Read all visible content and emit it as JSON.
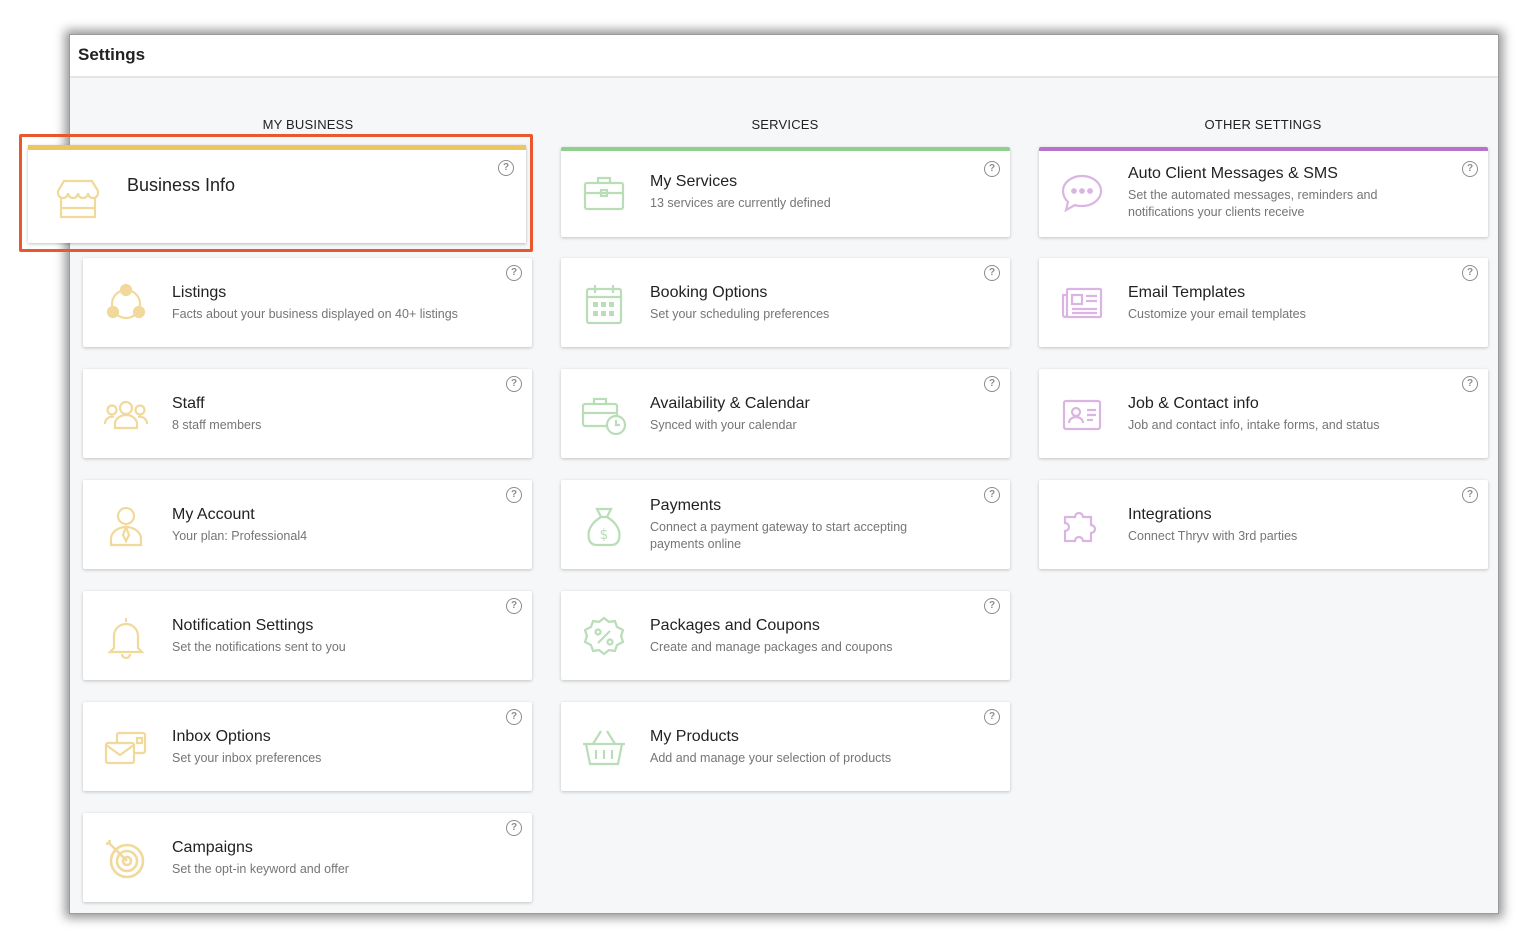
{
  "window": {
    "title": "Settings"
  },
  "colors": {
    "business": "#ecc75f",
    "services": "#8fd18c",
    "other": "#b673c9",
    "business_icon": "#f0d99a",
    "services_icon": "#b9ddb7",
    "other_icon": "#dab5e3",
    "highlight": "#e8582c"
  },
  "columns": {
    "business": {
      "heading": "MY BUSINESS"
    },
    "services": {
      "heading": "SERVICES"
    },
    "other": {
      "heading": "OTHER SETTINGS"
    }
  },
  "help_glyph": "?",
  "business_cards": [
    {
      "title": "Business Info",
      "subtitle": "",
      "icon": "storefront-icon"
    },
    {
      "title": "Listings",
      "subtitle": "Facts about your business displayed on 40+ listings",
      "icon": "network-icon"
    },
    {
      "title": "Staff",
      "subtitle": "8 staff members",
      "icon": "people-icon"
    },
    {
      "title": "My Account",
      "subtitle": "Your plan: Professional4",
      "icon": "person-icon"
    },
    {
      "title": "Notification Settings",
      "subtitle": "Set the notifications sent to you",
      "icon": "bell-icon"
    },
    {
      "title": "Inbox Options",
      "subtitle": "Set your inbox preferences",
      "icon": "envelopes-icon"
    },
    {
      "title": "Campaigns",
      "subtitle": "Set the opt-in keyword and offer",
      "icon": "target-icon"
    }
  ],
  "services_cards": [
    {
      "title": "My Services",
      "subtitle": "13 services are currently defined",
      "icon": "briefcase-icon"
    },
    {
      "title": "Booking Options",
      "subtitle": "Set your scheduling preferences",
      "icon": "calendar-icon"
    },
    {
      "title": "Availability & Calendar",
      "subtitle": "Synced with your calendar",
      "icon": "briefcase-clock-icon"
    },
    {
      "title": "Payments",
      "subtitle": "Connect a payment gateway to start accepting payments online",
      "icon": "money-bag-icon"
    },
    {
      "title": "Packages and Coupons",
      "subtitle": "Create and manage packages and coupons",
      "icon": "percent-badge-icon"
    },
    {
      "title": "My Products",
      "subtitle": "Add and manage your selection of products",
      "icon": "basket-icon"
    }
  ],
  "other_cards": [
    {
      "title": "Auto Client Messages & SMS",
      "subtitle": "Set the automated messages, reminders and notifications your clients receive",
      "icon": "chat-bubble-icon"
    },
    {
      "title": "Email Templates",
      "subtitle": "Customize your email templates",
      "icon": "newspaper-icon"
    },
    {
      "title": "Job & Contact info",
      "subtitle": "Job and contact info, intake forms, and status",
      "icon": "contact-card-icon"
    },
    {
      "title": "Integrations",
      "subtitle": "Connect Thryv with 3rd parties",
      "icon": "puzzle-icon"
    }
  ]
}
